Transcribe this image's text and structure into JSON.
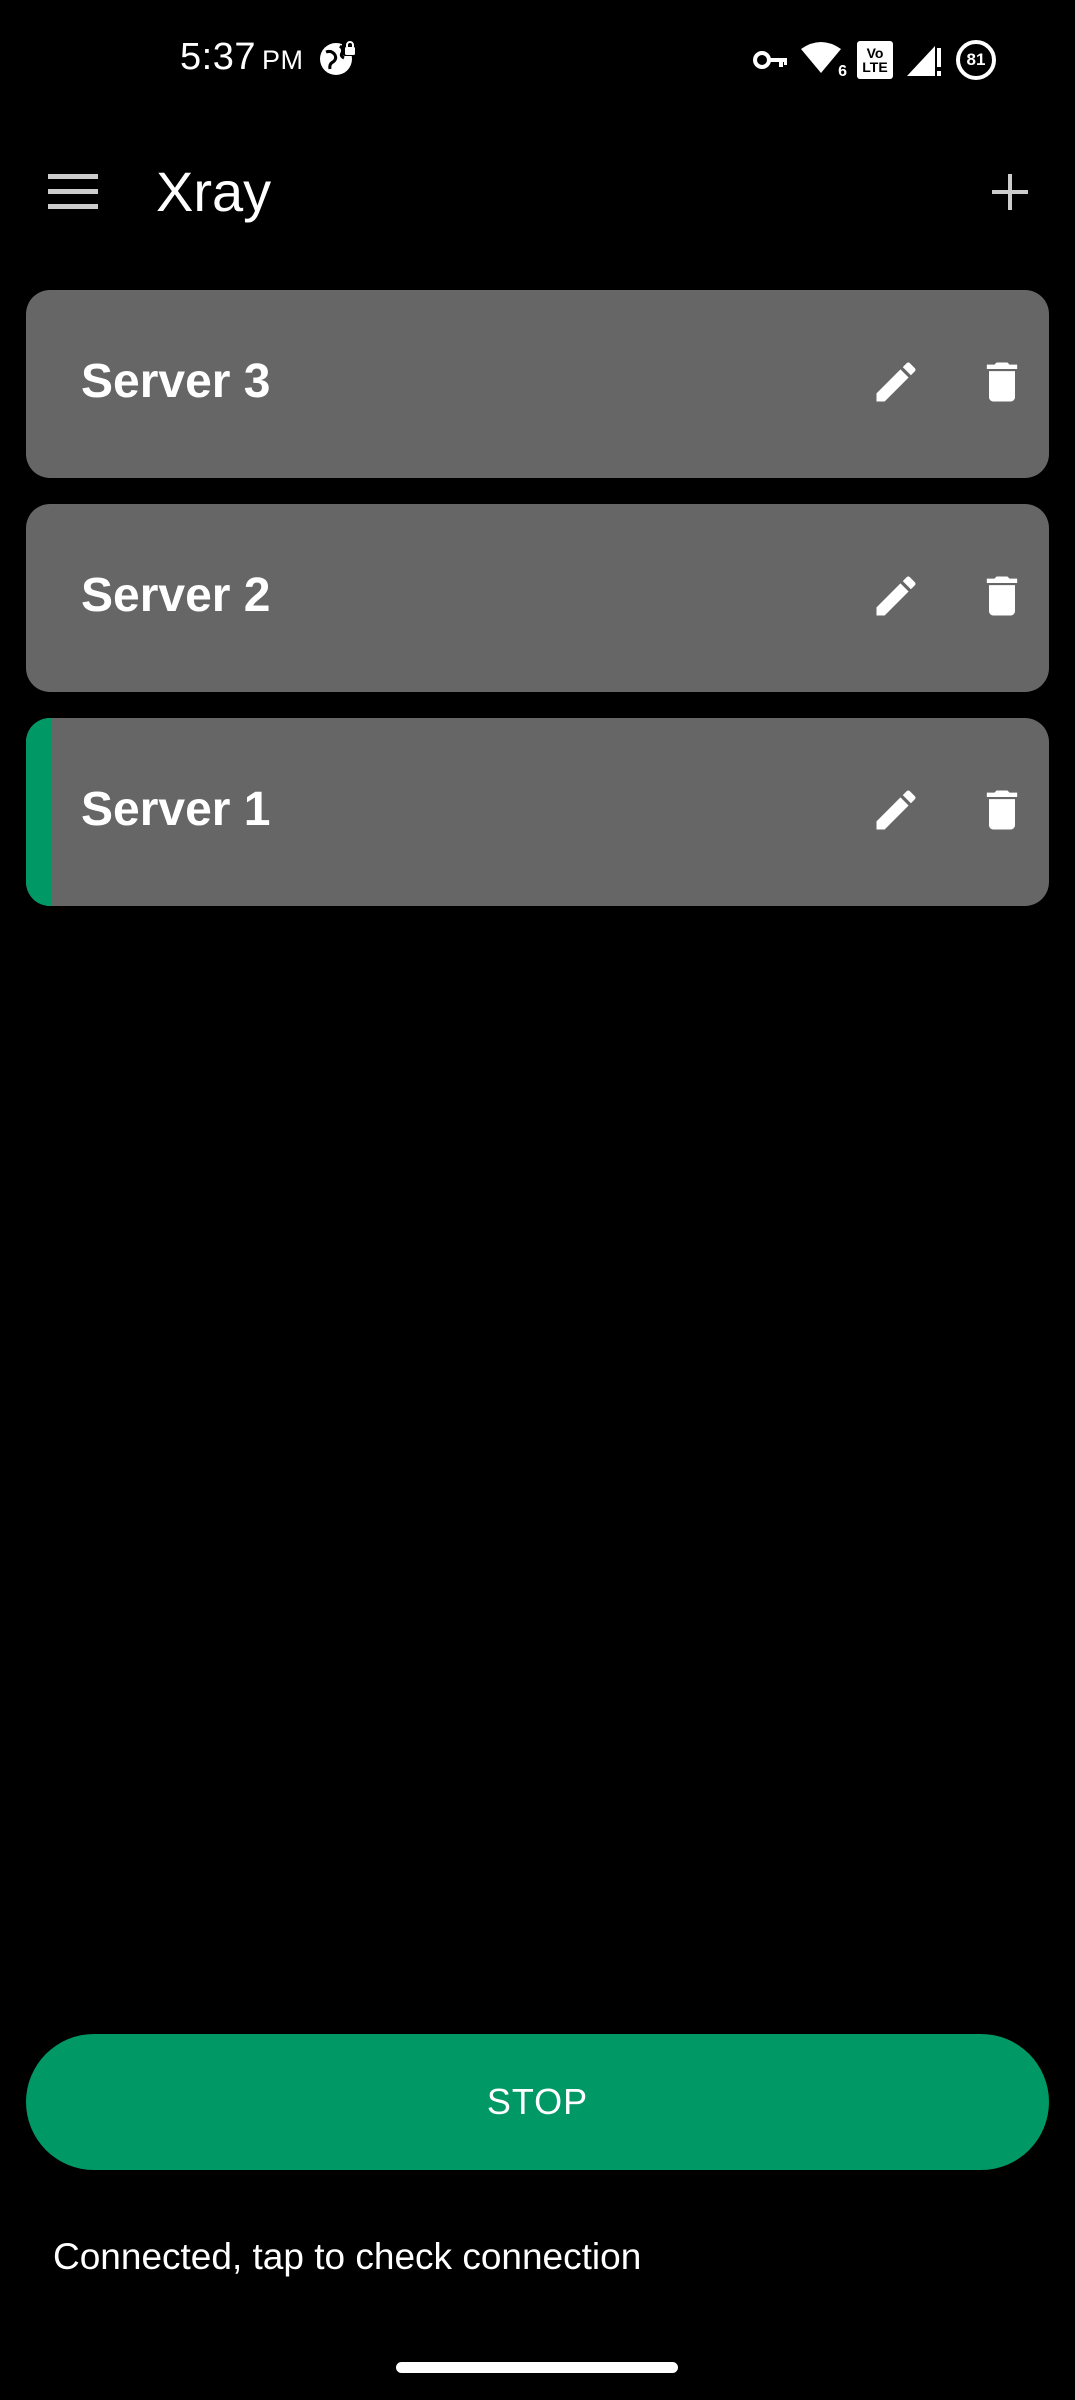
{
  "status_bar": {
    "time": "5:37",
    "ampm": "PM",
    "battery": "81",
    "wifi_badge": "6",
    "volte_top": "Vo",
    "volte_bottom": "LTE"
  },
  "app_bar": {
    "title": "Xray"
  },
  "servers": [
    {
      "name": "Server 3",
      "selected": false
    },
    {
      "name": "Server 2",
      "selected": false
    },
    {
      "name": "Server 1",
      "selected": true
    }
  ],
  "stop_button": {
    "label": "STOP"
  },
  "connection_status": "Connected, tap to check connection",
  "colors": {
    "background": "#000000",
    "card": "#666666",
    "accent": "#009966",
    "text": "#ffffff"
  },
  "icons": {
    "menu": "menu-icon",
    "add": "plus-icon",
    "edit": "pencil-icon",
    "delete": "trash-icon",
    "vpn": "key-icon",
    "wifi": "wifi-icon",
    "signal": "signal-icon",
    "battery": "battery-icon",
    "globe": "globe-icon"
  }
}
